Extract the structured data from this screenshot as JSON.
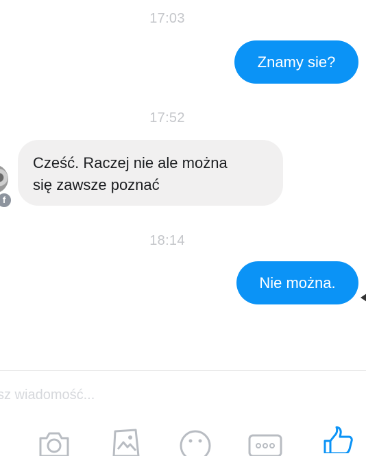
{
  "messages": [
    {
      "type": "timestamp",
      "text": "17:03"
    },
    {
      "type": "outgoing",
      "text": "Znamy sie?"
    },
    {
      "type": "timestamp",
      "text": "17:52"
    },
    {
      "type": "incoming",
      "lines": [
        "Cześć. Raczej nie ale można",
        "się zawsze poznać"
      ]
    },
    {
      "type": "timestamp",
      "text": "18:14"
    },
    {
      "type": "outgoing",
      "text": "Nie można."
    }
  ],
  "composer": {
    "placeholder": "sz wiadomość..."
  },
  "toolbar": {
    "icons": [
      "camera-icon",
      "gallery-icon",
      "emoji-icon",
      "more-icon",
      "like-icon"
    ]
  },
  "colors": {
    "outgoing_bubble": "#0b93f6",
    "incoming_bubble": "#f1f0f0",
    "timestamp_text": "#c4c6ca",
    "toolbar_icon": "#b8bcc2",
    "like_icon": "#0b93f6"
  }
}
